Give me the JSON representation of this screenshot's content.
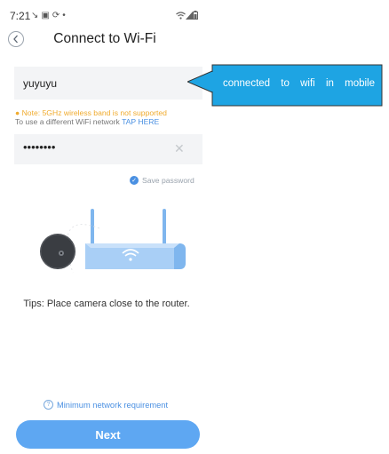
{
  "status_bar": {
    "time": "7:21",
    "left_icons": [
      "notification-icon",
      "gallery-icon",
      "sync-icon",
      "dot-icon"
    ],
    "right_icons": [
      "wifi-icon",
      "signal-icon",
      "battery-icon"
    ]
  },
  "header": {
    "title": "Connect to Wi-Fi",
    "back_icon": "chevron-left-icon"
  },
  "wifi_form": {
    "ssid_value": "yuyuyu",
    "note_text": "Note: 5GHz wireless band is not supported",
    "tap_prefix": "To use a different WiFi network ",
    "tap_link": "TAP HERE",
    "password_value": "••••••••",
    "clear_icon": "close-icon",
    "save_password_label": "Save password",
    "save_password_checked": true
  },
  "callout": {
    "text": "connected to wifi in mobile",
    "color": "#1ea4e3"
  },
  "illustration": {
    "camera_icon": "camera-icon",
    "router_icon": "router-icon",
    "wifi_icon": "wifi-icon"
  },
  "tips_text": "Tips: Place camera close to the router.",
  "min_requirement_label": "Minimum network requirement",
  "next_label": "Next",
  "colors": {
    "accent": "#4a90e2",
    "button": "#5ea7f2",
    "warning": "#f0ab2e",
    "field_bg": "#f3f4f6"
  }
}
